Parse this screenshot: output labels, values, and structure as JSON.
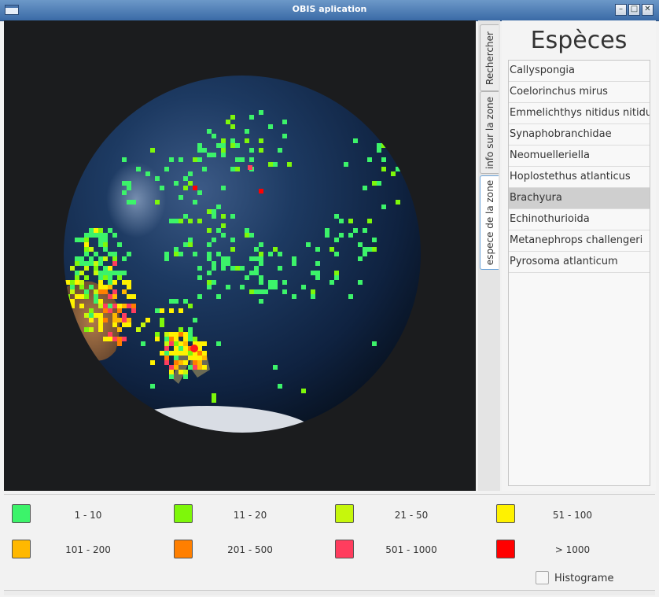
{
  "window": {
    "title": "OBIS aplication"
  },
  "tabs": [
    {
      "label": "Rechercher",
      "active": false
    },
    {
      "label": "info sur la zone",
      "active": false
    },
    {
      "label": "espece de la zone",
      "active": true
    }
  ],
  "species": {
    "title": "Espèces",
    "items": [
      "Callyspongia",
      "Coelorinchus mirus",
      "Emmelichthys nitidus nitidus",
      "Synaphobranchidae",
      "Neomuelleriella",
      "Hoplostethus atlanticus",
      "Brachyura",
      "Echinothurioida",
      "Metanephrops challengeri",
      "Pyrosoma atlanticum"
    ],
    "selected_index": 6
  },
  "legend": [
    {
      "label": "1 - 10",
      "color": "#3cf36a"
    },
    {
      "label": "11 - 20",
      "color": "#7ef70a"
    },
    {
      "label": "21 - 50",
      "color": "#c6f70c"
    },
    {
      "label": "51 - 100",
      "color": "#fff200"
    },
    {
      "label": "101 - 200",
      "color": "#ffb800"
    },
    {
      "label": "201 - 500",
      "color": "#ff7f00"
    },
    {
      "label": "501 - 1000",
      "color": "#ff3d5e"
    },
    {
      "label": "> 1000",
      "color": "#ff0000"
    }
  ],
  "histogram": {
    "label": "Histograme",
    "checked": false
  },
  "icons": {
    "minimize": "minimize-icon",
    "maximize": "maximize-icon",
    "close": "close-icon",
    "app": "window-icon"
  }
}
